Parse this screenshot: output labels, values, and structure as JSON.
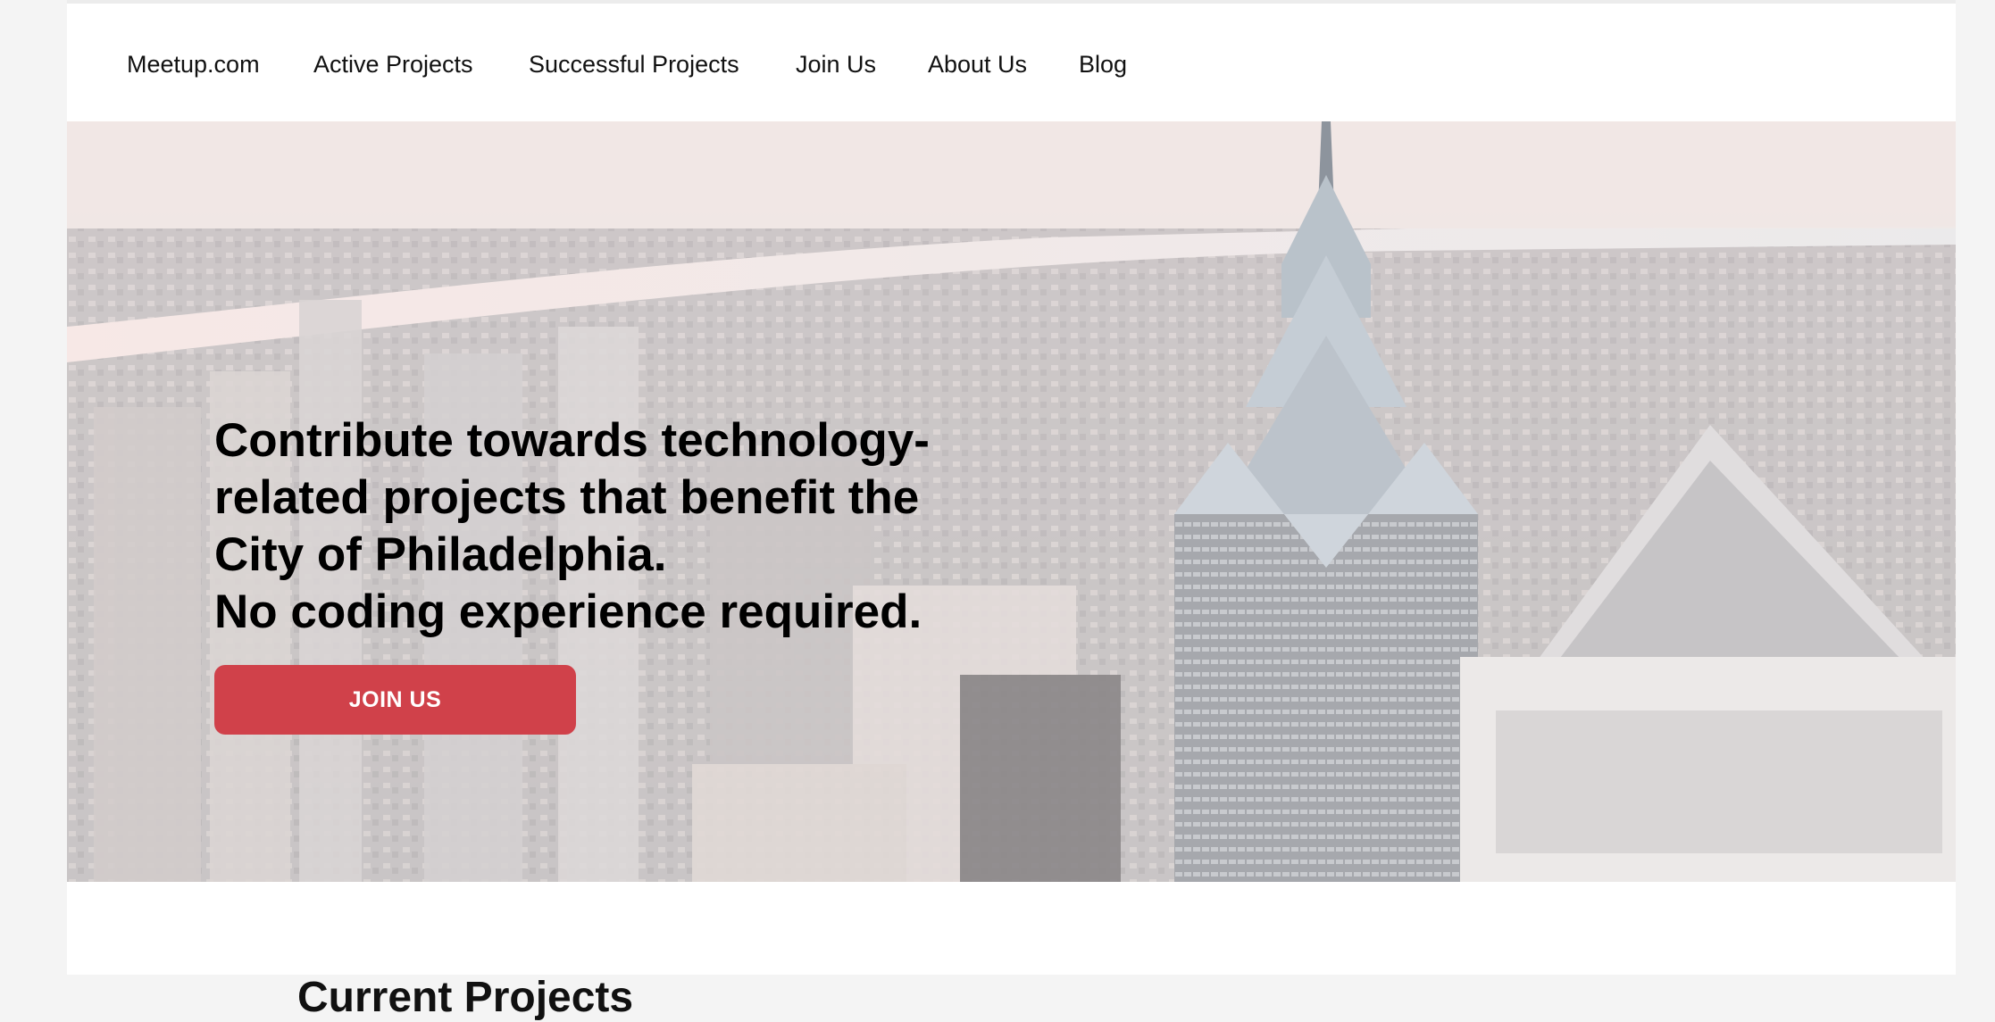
{
  "nav": {
    "items": [
      "Meetup.com",
      "Active Projects",
      "Successful Projects",
      "Join Us",
      "About Us",
      "Blog"
    ]
  },
  "hero": {
    "headline_lines": [
      "Contribute towards technology-",
      "related projects that benefit the",
      "City of Philadelphia.",
      "No coding experience required."
    ],
    "cta_label": "JOIN US",
    "image_description_icon": "philadelphia-skyline-image"
  },
  "sections": {
    "current_projects_title": "Current Projects"
  },
  "colors": {
    "accent": "#d0414a",
    "background": "#f4f4f4",
    "surface": "#ffffff"
  }
}
